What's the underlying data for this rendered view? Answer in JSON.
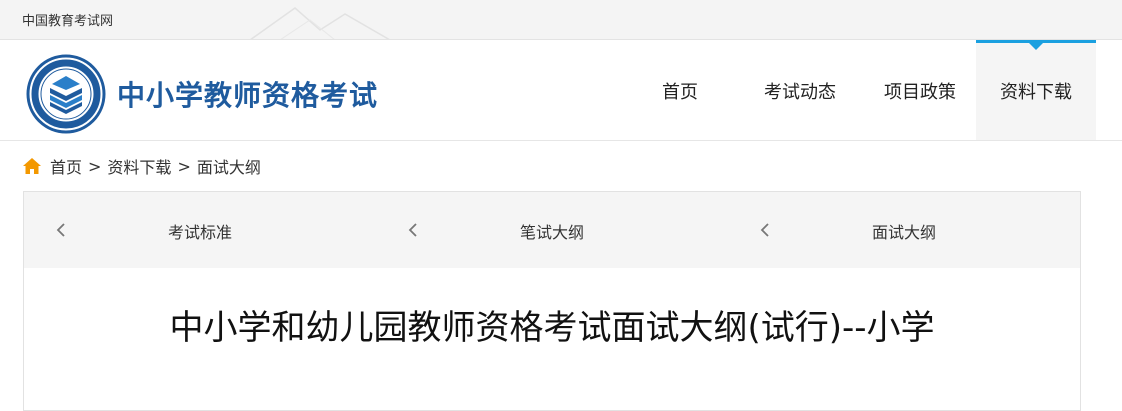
{
  "topbar": {
    "site_name": "中国教育考试网"
  },
  "header": {
    "brand": "中小学教师资格考试",
    "nav": [
      {
        "label": "首页",
        "active": false
      },
      {
        "label": "考试动态",
        "active": false
      },
      {
        "label": "项目政策",
        "active": false
      },
      {
        "label": "资料下载",
        "active": true
      }
    ]
  },
  "breadcrumb": {
    "items": [
      "首页",
      "资料下载",
      "面试大纲"
    ],
    "separator": ">"
  },
  "subnav": {
    "items": [
      "考试标准",
      "笔试大纲",
      "面试大纲"
    ]
  },
  "article": {
    "title": "中小学和幼儿园教师资格考试面试大纲(试行)--小学"
  },
  "colors": {
    "brand": "#1f5b9e",
    "accent": "#1aa0e0",
    "home_icon": "#f39800"
  }
}
